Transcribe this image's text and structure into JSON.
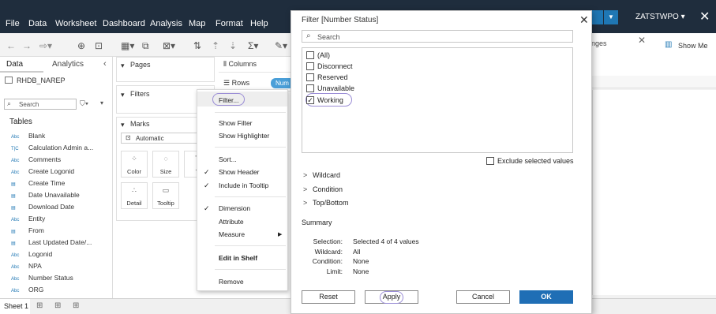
{
  "menubar": {
    "items": [
      "File",
      "Data",
      "Worksheet",
      "Dashboard",
      "Analysis",
      "Map",
      "Format",
      "Help"
    ],
    "user": "ZATSTWPO ▾",
    "close_icon": "close-icon",
    "dropdown_arrow": "▼"
  },
  "showme": {
    "partial_label": "nges",
    "close": "✕",
    "label": "Show Me"
  },
  "datapane": {
    "tab_data": "Data",
    "tab_analytics": "Analytics",
    "collapse": "‹",
    "source": "RHDB_NAREP",
    "search_placeholder": "Search",
    "filter_icon": "⛉▾",
    "more_icon": "▾",
    "tables_label": "Tables",
    "fields": [
      {
        "type": "Abc",
        "name": "Blank"
      },
      {
        "type": "T|C",
        "name": "Calculation Admin a..."
      },
      {
        "type": "Abc",
        "name": "Comments"
      },
      {
        "type": "Abc",
        "name": "Create Logonid"
      },
      {
        "type": "▤",
        "name": "Create Time"
      },
      {
        "type": "▤",
        "name": "Date Unavailable"
      },
      {
        "type": "▤",
        "name": "Download Date"
      },
      {
        "type": "Abc",
        "name": "Entity"
      },
      {
        "type": "▤",
        "name": "From"
      },
      {
        "type": "▤",
        "name": "Last Updated Date/..."
      },
      {
        "type": "Abc",
        "name": "Logonid"
      },
      {
        "type": "Abc",
        "name": "NPA"
      },
      {
        "type": "Abc",
        "name": "Number Status"
      },
      {
        "type": "Abc",
        "name": "ORG"
      }
    ]
  },
  "cards": {
    "pages": "Pages",
    "filters": "Filters",
    "marks": "Marks",
    "marks_type": "Automatic",
    "mark_buttons": [
      {
        "icon": "⁘",
        "label": "Color"
      },
      {
        "icon": "◌",
        "label": "Size"
      },
      {
        "icon": "T",
        "label": "T"
      },
      {
        "icon": "∴",
        "label": "Detail"
      },
      {
        "icon": "▭",
        "label": "Tooltip"
      }
    ]
  },
  "shelves": {
    "columns": "Columns",
    "rows": "Rows",
    "rows_pill": "Num"
  },
  "bottom": {
    "sheet_tab": "Sheet 1"
  },
  "context_menu": {
    "filter": "Filter...",
    "show_filter": "Show Filter",
    "show_highlighter": "Show Highlighter",
    "sort": "Sort...",
    "show_header": "Show Header",
    "include_tooltip": "Include in Tooltip",
    "dimension": "Dimension",
    "attribute": "Attribute",
    "measure": "Measure",
    "edit_in_shelf": "Edit in Shelf",
    "remove": "Remove",
    "check": "✓",
    "submenu_arrow": "▶"
  },
  "dialog": {
    "title": "Filter [Number Status]",
    "close": "✕",
    "search_placeholder": "Search",
    "options": [
      {
        "label": "(All)",
        "checked": false
      },
      {
        "label": "Disconnect",
        "checked": false
      },
      {
        "label": "Reserved",
        "checked": false
      },
      {
        "label": "Unavailable",
        "checked": false
      },
      {
        "label": "Working",
        "checked": true
      }
    ],
    "check_mark": "✓",
    "exclude_label": "Exclude selected values",
    "sections": [
      "Wildcard",
      "Condition",
      "Top/Bottom"
    ],
    "chevron": ">",
    "summary_title": "Summary",
    "summary": [
      {
        "key": "Selection:",
        "value": "Selected 4 of 4 values"
      },
      {
        "key": "Wildcard:",
        "value": "All"
      },
      {
        "key": "Condition:",
        "value": "None"
      },
      {
        "key": "Limit:",
        "value": "None"
      }
    ],
    "buttons": {
      "reset": "Reset",
      "apply": "Apply",
      "cancel": "Cancel",
      "ok": "OK"
    }
  }
}
